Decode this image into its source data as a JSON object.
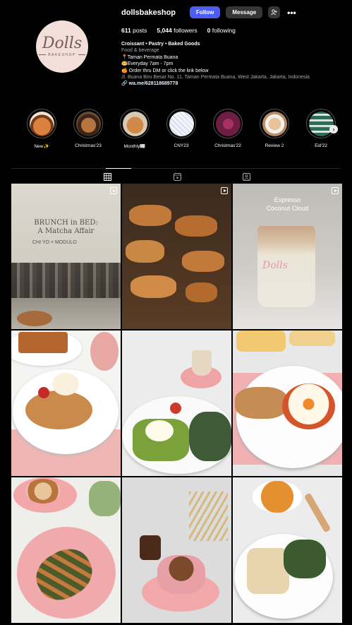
{
  "profile": {
    "username": "dollsbakeshop",
    "follow_label": "Follow",
    "message_label": "Message",
    "logo_text": "Dolls",
    "logo_sub": "BAKESHOP"
  },
  "stats": {
    "posts_value": "611",
    "posts_label": "posts",
    "followers_value": "5,044",
    "followers_label": "followers",
    "following_value": "0",
    "following_label": "following"
  },
  "bio": {
    "name": "Croissant • Pastry • Baked Goods",
    "category": "Food & beverage",
    "line1": "📍Taman Permata Buana",
    "line2": "🥯Everyday 7am - 7pm",
    "line3": "🍊 Order thru DM or click the link below",
    "address": "Jl. Buana Biru Besar No. 11, Taman Permata Buana, West Jakarta, Jakarta, Indonesia",
    "link": "wa.me/628118689778"
  },
  "highlights": [
    {
      "label": "New✨",
      "color": "#c86b3a"
    },
    {
      "label": "Christmas'23",
      "color": "#8d5a3b"
    },
    {
      "label": "Monthly📰",
      "color": "#c9884c"
    },
    {
      "label": "CNY23",
      "color": "#e9ecf5"
    },
    {
      "label": "Christmas'22",
      "color": "#7a1f4a"
    },
    {
      "label": "Review 2",
      "color": "#d9b48a"
    },
    {
      "label": "Eid'22",
      "color": "#3c7a6a"
    }
  ],
  "posts": {
    "p1_title": "BRUNCH in BED:",
    "p1_sub": "A Matcha Affair",
    "p1_brand1": "CHI YO",
    "p1_brand2": "MODULO",
    "p3_title": "Espresso",
    "p3_sub": "Coconut Cloud",
    "p3_cup": "Dolls"
  }
}
